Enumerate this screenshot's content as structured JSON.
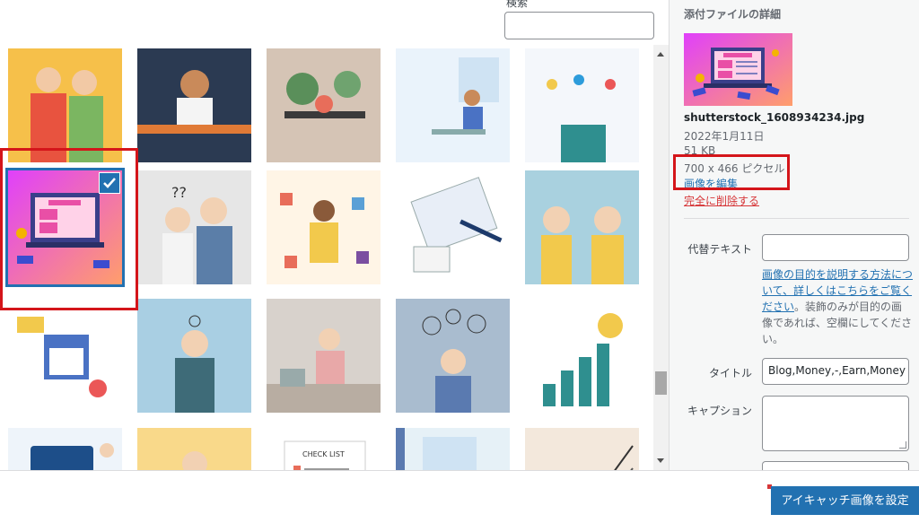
{
  "search": {
    "label": "検索",
    "value": ""
  },
  "sidebar": {
    "title": "添付ファイルの詳細",
    "filename": "shutterstock_1608934234.jpg",
    "date": "2022年1月11日",
    "filesize": "51 KB",
    "dimensions": "700 x 466 ピクセル",
    "edit_link": "画像を編集",
    "delete_link": "完全に削除する",
    "alt_label": "代替テキスト",
    "alt_value": "",
    "help_link": "画像の目的を説明する方法について、詳しくはこちらをご覧ください",
    "help_rest": "。装飾のみが目的の画像であれば、空欄にしてください。",
    "title_label": "タイトル",
    "title_value": "Blog,Money,-,Earn,Money",
    "caption_label": "キャプション",
    "caption_value": ""
  },
  "media": [
    {
      "name": "thumb-couple-thumbs-down",
      "bg": "#f6c04a"
    },
    {
      "name": "thumb-thinking-woman-desk",
      "bg": "#2b3a52"
    },
    {
      "name": "thumb-plants-desk",
      "bg": "#d5c4b5"
    },
    {
      "name": "thumb-woman-working-window",
      "bg": "#eaf3fb"
    },
    {
      "name": "thumb-people-jumping",
      "bg": "#f4f7fb"
    },
    {
      "name": "thumb-blog-laptop",
      "bg": "#c94fe0",
      "selected": true
    },
    {
      "name": "thumb-confused-couple",
      "bg": "#e6e6e6"
    },
    {
      "name": "thumb-woman-puzzle",
      "bg": "#fff5e6"
    },
    {
      "name": "thumb-documents-pen",
      "bg": "#ffffff"
    },
    {
      "name": "thumb-shocked-women",
      "bg": "#a9d1df"
    },
    {
      "name": "thumb-online-shopping",
      "bg": "#ffffff"
    },
    {
      "name": "thumb-stressed-man",
      "bg": "#a9cfe3"
    },
    {
      "name": "thumb-woman-reading-paper",
      "bg": "#d8d2cc"
    },
    {
      "name": "thumb-woman-thoughts",
      "bg": "#a9bccf"
    },
    {
      "name": "thumb-bulb-chart",
      "bg": "#ffffff"
    },
    {
      "name": "thumb-chat-bubble",
      "bg": "#eef4fa"
    },
    {
      "name": "thumb-stressed-woman",
      "bg": "#f9d98a"
    },
    {
      "name": "thumb-checklist",
      "bg": "#ffffff"
    },
    {
      "name": "thumb-room-window",
      "bg": "#e6f1f7"
    },
    {
      "name": "thumb-arrows-growth",
      "bg": "#f3e8dc"
    }
  ],
  "footer": {
    "button_label": "アイキャッチ画像を設定"
  },
  "colors": {
    "accent": "#2271b1",
    "highlight": "#d4151a",
    "danger": "#d63638"
  }
}
